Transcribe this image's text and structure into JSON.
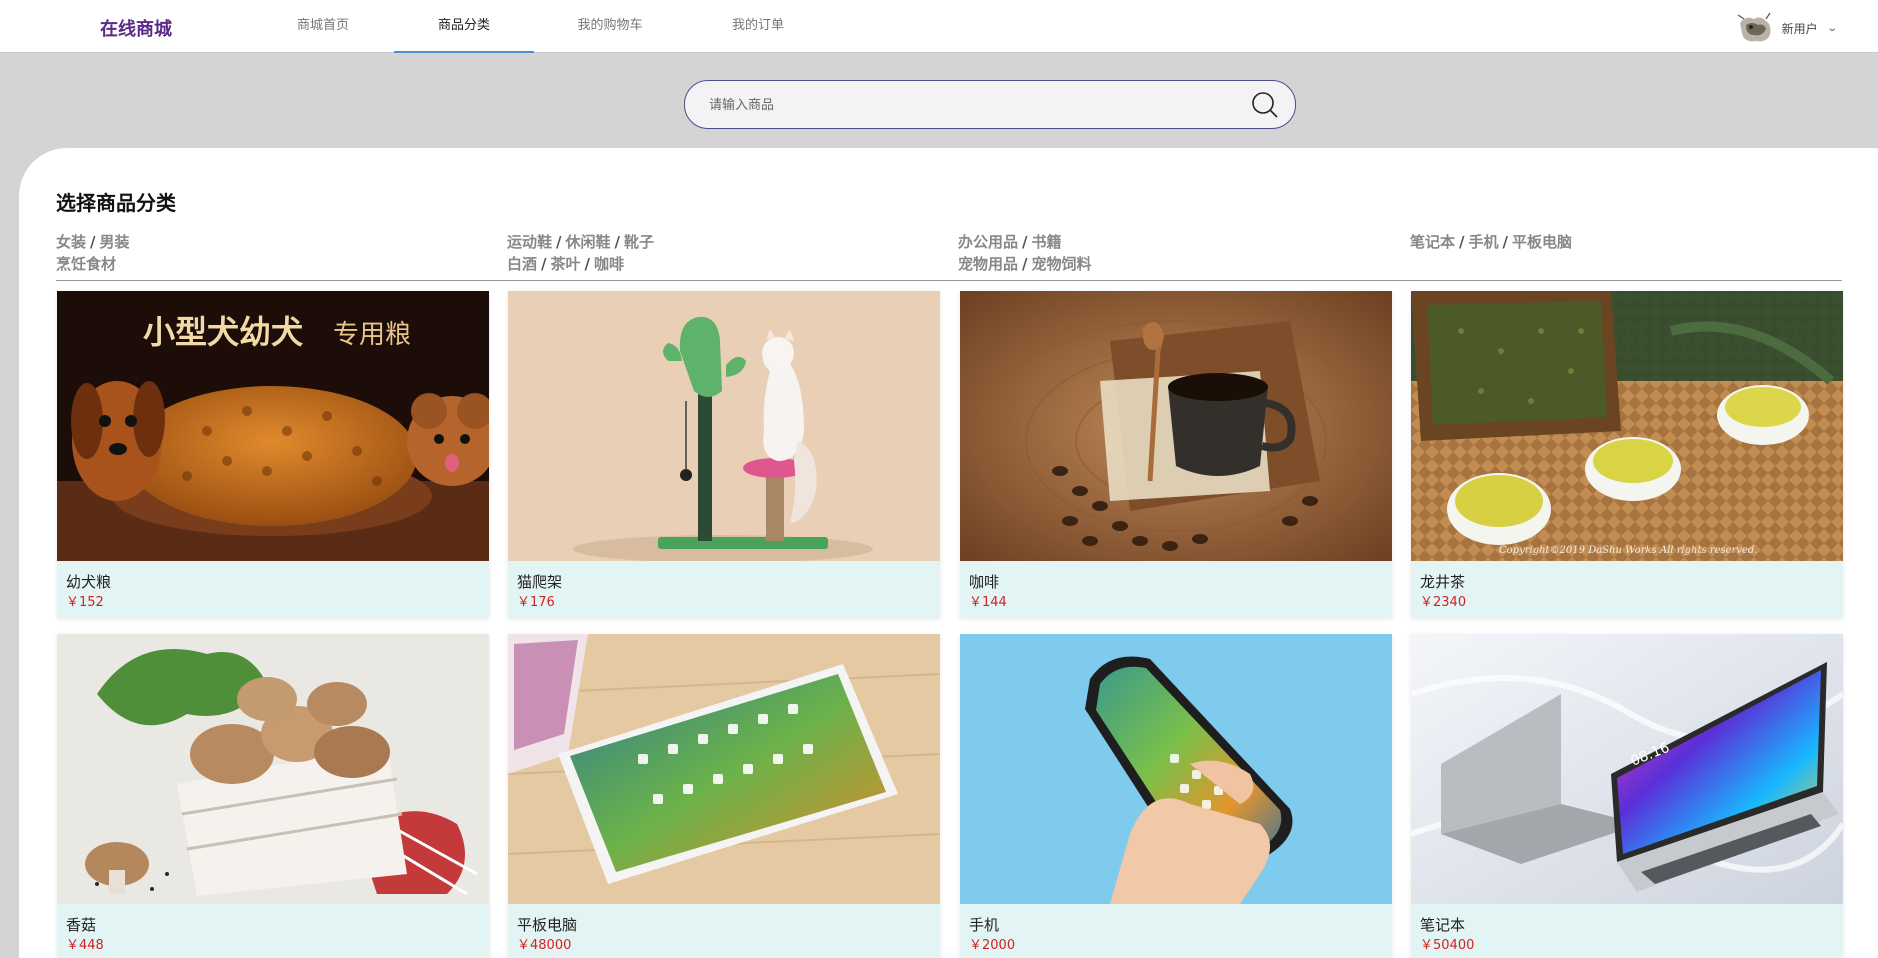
{
  "brand": {
    "name": "在线商城",
    "color": "#5b2a86"
  },
  "nav": {
    "items": [
      {
        "label": "商城首页"
      },
      {
        "label": "商品分类",
        "active": true
      },
      {
        "label": "我的购物车"
      },
      {
        "label": "我的订单"
      }
    ],
    "active_color": "#4a8fd8"
  },
  "user": {
    "name": "新用户",
    "avatar_icon": "avatar-image",
    "dropdown_icon": "chevron-down-icon"
  },
  "search": {
    "placeholder": "请输入商品",
    "value": "",
    "icon": "search-icon",
    "border_color": "#4a4f8c"
  },
  "section": {
    "title": "选择商品分类"
  },
  "categories": [
    {
      "lines": [
        [
          "女装",
          "男装"
        ],
        [
          "烹饪食材"
        ]
      ]
    },
    {
      "lines": [
        [
          "运动鞋",
          "休闲鞋",
          "靴子"
        ],
        [
          "白酒",
          "茶叶",
          "咖啡"
        ]
      ]
    },
    {
      "lines": [
        [
          "办公用品",
          "书籍"
        ],
        [
          "宠物用品",
          "宠物饲料"
        ]
      ]
    },
    {
      "lines": [
        [
          "笔记本",
          "手机",
          "平板电脑"
        ]
      ]
    }
  ],
  "products": [
    {
      "name": "幼犬粮",
      "price": "￥152",
      "banner_text": "小型犬幼犬",
      "banner_sub": "专用粮",
      "image": "dog-food"
    },
    {
      "name": "猫爬架",
      "price": "￥176",
      "image": "cat-tree"
    },
    {
      "name": "咖啡",
      "price": "￥144",
      "image": "coffee"
    },
    {
      "name": "龙井茶",
      "price": "￥2340",
      "watermark": "Copyright©2019 DaShu Works All rights reserved.",
      "image": "tea"
    },
    {
      "name": "香菇",
      "price": "￥448",
      "image": "mushroom"
    },
    {
      "name": "平板电脑",
      "price": "￥48000",
      "image": "tablet"
    },
    {
      "name": "手机",
      "price": "￥2000",
      "image": "phone"
    },
    {
      "name": "笔记本",
      "price": "￥50400",
      "screen_time": "08:16",
      "image": "laptop"
    }
  ],
  "colors": {
    "price": "#d32222",
    "card_bg": "#e3f4f4",
    "page_bg": "#d4d4d4"
  }
}
